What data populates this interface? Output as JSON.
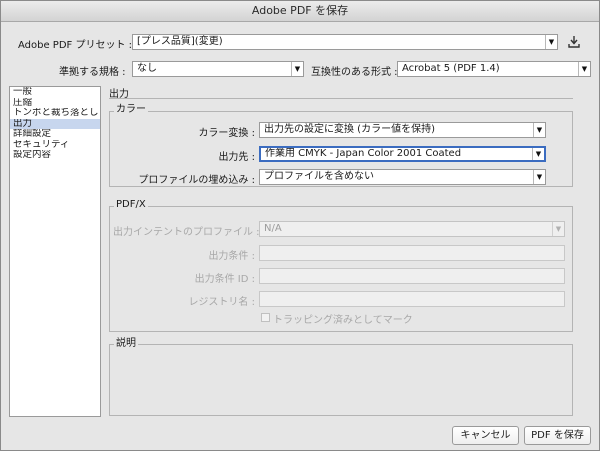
{
  "window": {
    "title": "Adobe PDF を保存"
  },
  "preset": {
    "label": "Adobe PDF プリセット :",
    "value": "[プレス品質](変更)",
    "save_icon": "save-preset-icon"
  },
  "standard": {
    "label": "準拠する規格 :",
    "value": "なし"
  },
  "compat": {
    "label": "互換性のある形式 :",
    "value": "Acrobat 5 (PDF 1.4)"
  },
  "sidebar": {
    "items": [
      {
        "label": "一般"
      },
      {
        "label": "圧縮"
      },
      {
        "label": "トンボと裁ち落とし"
      },
      {
        "label": "出力"
      },
      {
        "label": "詳細設定"
      },
      {
        "label": "セキュリティ"
      },
      {
        "label": "設定内容"
      }
    ]
  },
  "main": {
    "section_title": "出力"
  },
  "color": {
    "group_title": "カラー",
    "conversion_label": "カラー変換 :",
    "conversion_value": "出力先の設定に変換 (カラー値を保持)",
    "destination_label": "出力先 :",
    "destination_value": "作業用 CMYK - Japan Color 2001 Coated",
    "profile_label": "プロファイルの埋め込み :",
    "profile_value": "プロファイルを含めない"
  },
  "pdfx": {
    "group_title": "PDF/X",
    "intent_label": "出力インテントのプロファイル :",
    "intent_value": "N/A",
    "condition_label": "出力条件 :",
    "condition_id_label": "出力条件 ID :",
    "registry_label": "レジストリ名 :",
    "trapped_label": "トラッピング済みとしてマーク"
  },
  "description": {
    "group_title": "説明"
  },
  "buttons": {
    "cancel": "キャンセル",
    "save": "PDF を保存"
  }
}
